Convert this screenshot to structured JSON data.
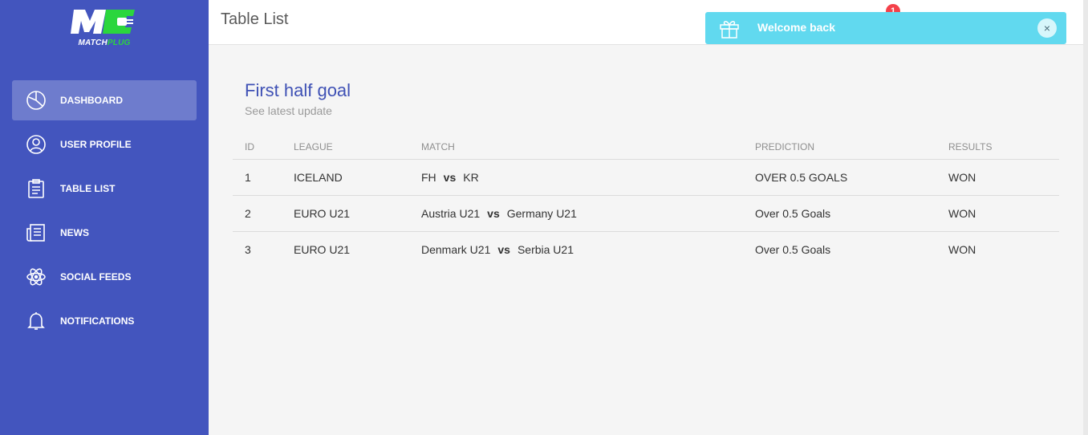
{
  "app": {
    "logo_text_1": "MATCH",
    "logo_text_2": "PLUG"
  },
  "sidebar": {
    "items": [
      {
        "label": "DASHBOARD",
        "icon": "pie-chart-icon",
        "active": true
      },
      {
        "label": "USER PROFILE",
        "icon": "user-icon",
        "active": false
      },
      {
        "label": "TABLE LIST",
        "icon": "clipboard-icon",
        "active": false
      },
      {
        "label": "NEWS",
        "icon": "newspaper-icon",
        "active": false
      },
      {
        "label": "SOCIAL FEEDS",
        "icon": "atom-icon",
        "active": false
      },
      {
        "label": "NOTIFICATIONS",
        "icon": "bell-icon",
        "active": false
      }
    ]
  },
  "header": {
    "title": "Table List",
    "notification_count": "1"
  },
  "toast": {
    "message": "Welcome back",
    "close_label": "×"
  },
  "card": {
    "title": "First half goal",
    "subtitle": "See latest update"
  },
  "table": {
    "columns": [
      "ID",
      "LEAGUE",
      "MATCH",
      "PREDICTION",
      "RESULTS"
    ],
    "vs_label": "vs",
    "rows": [
      {
        "id": "1",
        "league": "ICELAND",
        "home": "FH",
        "away": "KR",
        "prediction": "OVER 0.5 GOALS",
        "result": "WON"
      },
      {
        "id": "2",
        "league": "EURO U21",
        "home": "Austria U21",
        "away": "Germany U21",
        "prediction": "Over 0.5 Goals",
        "result": "WON"
      },
      {
        "id": "3",
        "league": "EURO U21",
        "home": "Denmark U21",
        "away": "Serbia U21",
        "prediction": "Over 0.5 Goals",
        "result": "WON"
      }
    ]
  },
  "colors": {
    "sidebar": "#4355be",
    "accent": "#3f51b5",
    "toast": "#61d9ef",
    "badge": "#f4414a",
    "logo_green": "#2bd63d"
  }
}
